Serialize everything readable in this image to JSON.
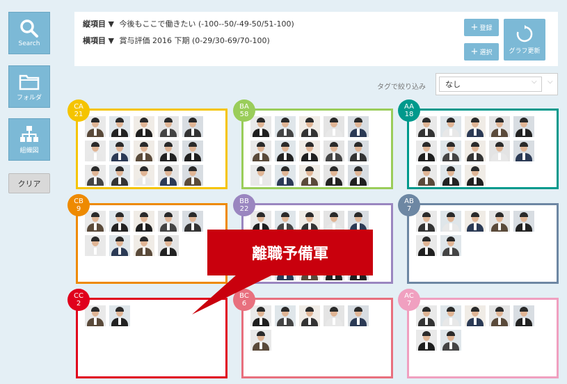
{
  "sidebar": {
    "search_label": "Search",
    "folder_label": "フォルダ",
    "org_label": "組織図",
    "clear_label": "クリア"
  },
  "header": {
    "vertical_axis_name": "縦項目",
    "vertical_axis_value": "今後もここで働きたい  (-100--50/-49-50/51-100)",
    "horizontal_axis_name": "横項目",
    "horizontal_axis_value": "賞与評価 2016 下期  (0-29/30-69/70-100)",
    "register_label": "登録",
    "select_label": "選択",
    "graph_update_label": "グラフ更新"
  },
  "filter": {
    "tag_label": "タグで絞り込み",
    "selected": "なし"
  },
  "callout": {
    "text": "離職予備軍"
  },
  "colors": {
    "CA": "#f5c400",
    "BA": "#9acd5a",
    "AA": "#00998c",
    "CB": "#ee8a00",
    "BB": "#9a86c0",
    "AB": "#6d87a3",
    "CC": "#e0001c",
    "BC": "#e8707e",
    "AC": "#f0a0c0",
    "accent": "#7cb9d6",
    "callout": "#c9000d"
  },
  "groups": [
    {
      "code": "CA",
      "count": "21",
      "shown": 15
    },
    {
      "code": "BA",
      "count": "58",
      "shown": 15
    },
    {
      "code": "AA",
      "count": "18",
      "shown": 13
    },
    {
      "code": "CB",
      "count": "9",
      "shown": 9
    },
    {
      "code": "BB",
      "count": "22",
      "shown": 15
    },
    {
      "code": "AB",
      "count": "7",
      "shown": 7
    },
    {
      "code": "CC",
      "count": "2",
      "shown": 2
    },
    {
      "code": "BC",
      "count": "6",
      "shown": 6
    },
    {
      "code": "AC",
      "count": "7",
      "shown": 7
    }
  ]
}
